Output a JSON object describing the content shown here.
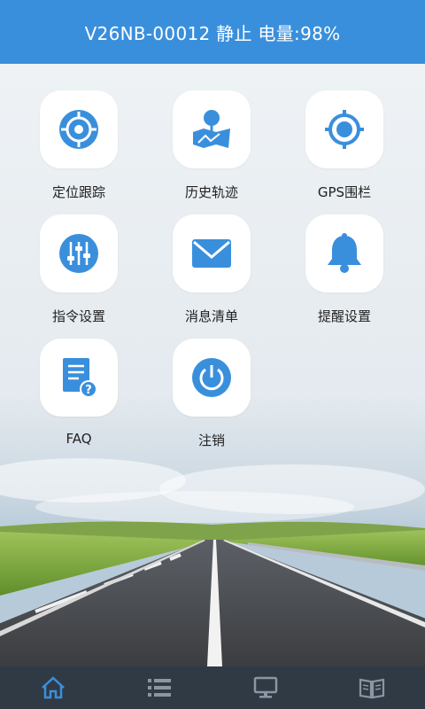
{
  "header": {
    "title": "V26NB-00012 静止 电量:98%"
  },
  "menu": [
    {
      "label": "定位跟踪",
      "icon": "crosshair-target-icon"
    },
    {
      "label": "历史轨迹",
      "icon": "map-pin-track-icon"
    },
    {
      "label": "GPS围栏",
      "icon": "gps-fence-icon"
    },
    {
      "label": "指令设置",
      "icon": "sliders-icon"
    },
    {
      "label": "消息清单",
      "icon": "envelope-icon"
    },
    {
      "label": "提醒设置",
      "icon": "bell-icon"
    },
    {
      "label": "FAQ",
      "icon": "document-question-icon"
    },
    {
      "label": "注销",
      "icon": "power-icon"
    }
  ],
  "tabbar": [
    {
      "icon": "home-icon",
      "active": true
    },
    {
      "icon": "list-icon",
      "active": false
    },
    {
      "icon": "monitor-icon",
      "active": false
    },
    {
      "icon": "book-icon",
      "active": false
    }
  ],
  "colors": {
    "accent": "#3a8fdc",
    "tabbar": "#303a45",
    "tab_active": "#3a8fdc",
    "tab_inactive": "#8a96a3"
  }
}
